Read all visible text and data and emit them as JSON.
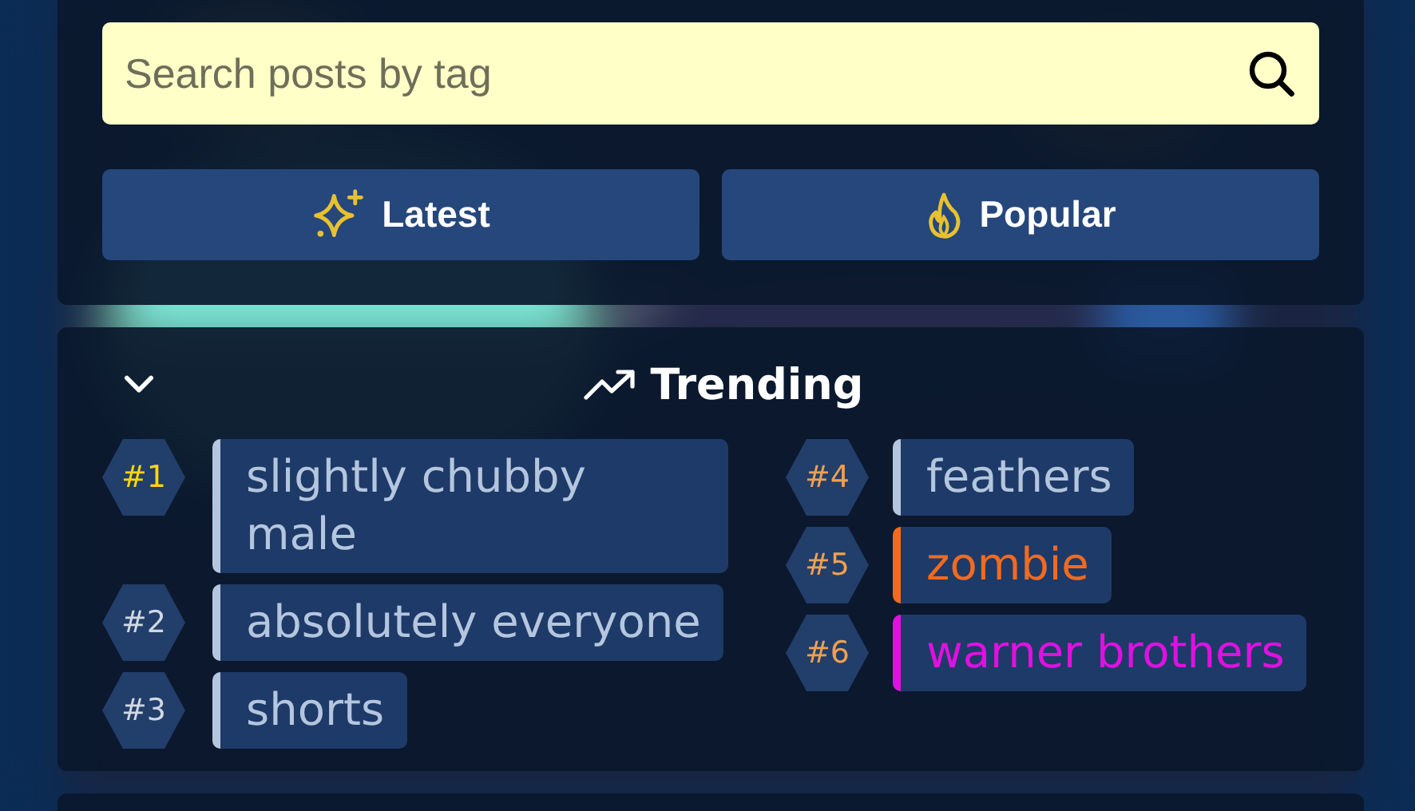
{
  "search": {
    "placeholder": "Search posts by tag"
  },
  "buttons": [
    {
      "label": "Latest",
      "kind": "sparkle"
    },
    {
      "label": "Popular",
      "kind": "flame"
    }
  ],
  "trending": {
    "title": "Trending",
    "expanded": true,
    "tags": [
      {
        "rank": "#1",
        "label": "slightly chubby male",
        "color": "#b4c6de"
      },
      {
        "rank": "#2",
        "label": "absolutely everyone",
        "color": "#b4c6de"
      },
      {
        "rank": "#3",
        "label": "shorts",
        "color": "#b4c6de"
      },
      {
        "rank": "#4",
        "label": "feathers",
        "color": "#b4c6de"
      },
      {
        "rank": "#5",
        "label": "zombie",
        "color": "#f26a1f"
      },
      {
        "rank": "#6",
        "label": "warner brothers",
        "color": "#e010e0"
      }
    ]
  }
}
